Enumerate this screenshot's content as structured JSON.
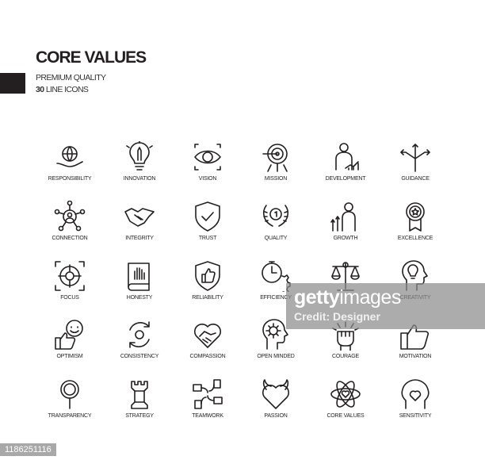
{
  "header": {
    "title": "CORE VALUES",
    "subtitle": "PREMIUM QUALITY",
    "count_bold": "30",
    "count_text": "LINE ICONS"
  },
  "icons": [
    {
      "label": "RESPONSIBILITY",
      "icon": "globe-hand-icon"
    },
    {
      "label": "INNOVATION",
      "icon": "lightbulb-pencil-icon"
    },
    {
      "label": "VISION",
      "icon": "eye-target-icon"
    },
    {
      "label": "MISSION",
      "icon": "target-arrow-icon"
    },
    {
      "label": "DEVELOPMENT",
      "icon": "person-chart-icon"
    },
    {
      "label": "GUIDANCE",
      "icon": "split-arrows-icon"
    },
    {
      "label": "CONNECTION",
      "icon": "network-person-icon"
    },
    {
      "label": "INTEGRITY",
      "icon": "handshake-icon"
    },
    {
      "label": "TRUST",
      "icon": "shield-check-icon"
    },
    {
      "label": "QUALITY",
      "icon": "laurel-medal-icon"
    },
    {
      "label": "GROWTH",
      "icon": "person-arrows-up-icon"
    },
    {
      "label": "EXCELLENCE",
      "icon": "award-badge-icon"
    },
    {
      "label": "FOCUS",
      "icon": "focus-target-icon"
    },
    {
      "label": "HONESTY",
      "icon": "hand-on-book-icon"
    },
    {
      "label": "RELIABILITY",
      "icon": "shield-thumbs-up-icon"
    },
    {
      "label": "EFFICIENCY",
      "icon": "stopwatch-gear-icon"
    },
    {
      "label": "",
      "icon": "scales-icon"
    },
    {
      "label": "CREATIVITY",
      "icon": "head-lightbulb-icon"
    },
    {
      "label": "OPTIMISM",
      "icon": "thumbs-up-smile-icon"
    },
    {
      "label": "CONSISTENCY",
      "icon": "refresh-cycle-icon"
    },
    {
      "label": "COMPASSION",
      "icon": "heart-handshake-icon"
    },
    {
      "label": "OPEN MINDED",
      "icon": "head-gear-icon"
    },
    {
      "label": "COURAGE",
      "icon": "raised-fist-icon"
    },
    {
      "label": "MOTIVATION",
      "icon": "thumbs-up-icon"
    },
    {
      "label": "TRANSPARENCY",
      "icon": "magnifier-icon"
    },
    {
      "label": "STRATEGY",
      "icon": "chess-rook-icon"
    },
    {
      "label": "TEAMWORK",
      "icon": "joined-hands-icon"
    },
    {
      "label": "PASSION",
      "icon": "devil-heart-icon"
    },
    {
      "label": "CORE VALUES",
      "icon": "atom-heart-icon"
    },
    {
      "label": "SENSITIVITY",
      "icon": "head-heart-icon"
    }
  ],
  "watermark": {
    "brand_bold": "getty",
    "brand_light": "images",
    "credit": "Credit: Designer"
  },
  "image_id": "1186251116"
}
